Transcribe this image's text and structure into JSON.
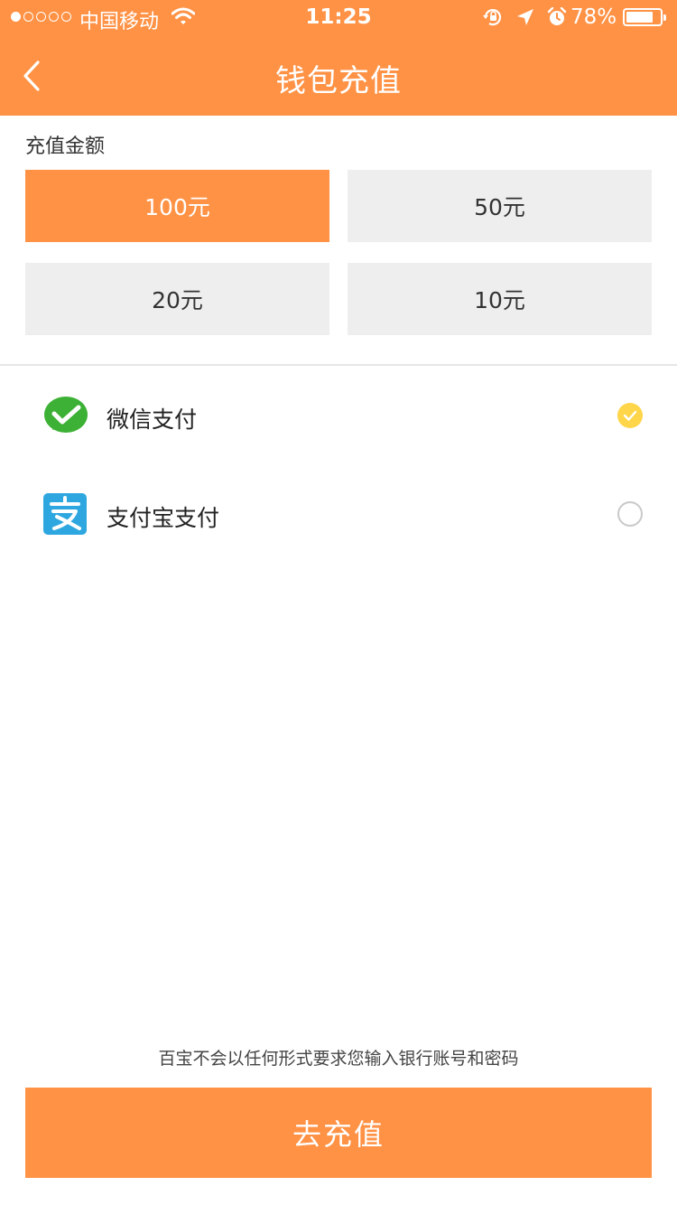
{
  "status_bar": {
    "carrier": "中国移动",
    "time": "11:25",
    "battery": "78%"
  },
  "nav": {
    "back_icon": "chevron-left-icon",
    "title": "钱包充值"
  },
  "amount_section": {
    "label": "充值金额",
    "options": [
      {
        "label": "100元",
        "selected": true
      },
      {
        "label": "50元",
        "selected": false
      },
      {
        "label": "20元",
        "selected": false
      },
      {
        "label": "10元",
        "selected": false
      }
    ]
  },
  "payment_methods": [
    {
      "label": "微信支付",
      "icon": "wechat-pay-icon",
      "checked": true
    },
    {
      "label": "支付宝支付",
      "icon": "alipay-icon",
      "checked": false
    }
  ],
  "notice": "百宝不会以任何形式要求您输入银行账号和密码",
  "submit_label": "去充值",
  "colors": {
    "accent": "#FF9245",
    "option_bg": "#EEEEEE",
    "check": "#FFD54A",
    "wechat_green": "#3DB135",
    "alipay_blue": "#2EA7E0"
  }
}
